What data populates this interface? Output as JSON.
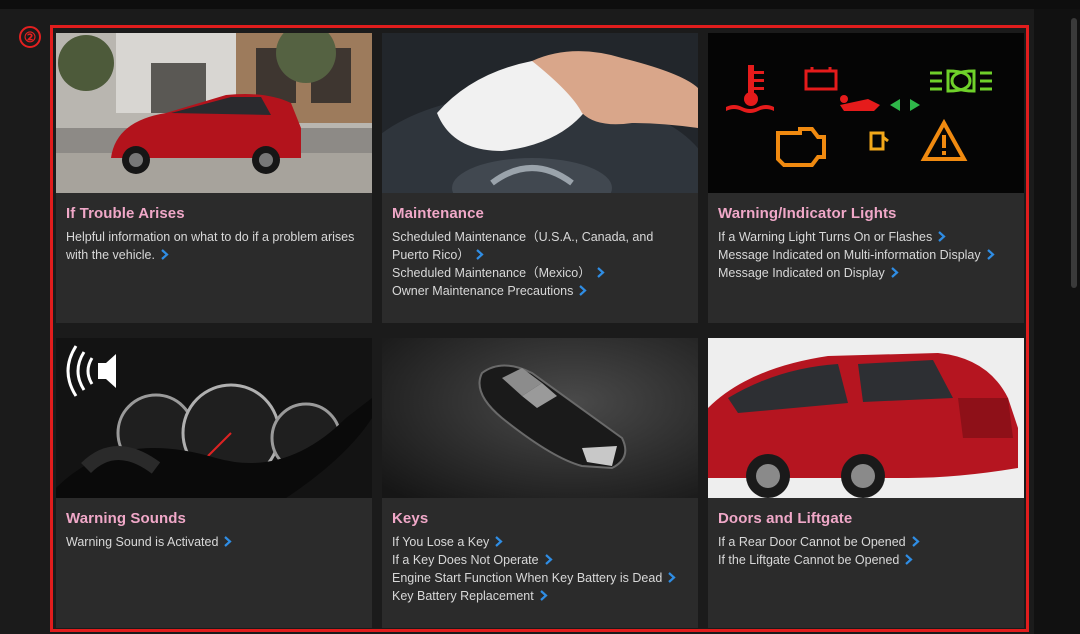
{
  "marker": {
    "label": "②"
  },
  "icons": {
    "chevron": "chevron-right-icon",
    "sound": "speaker-sound-icon"
  },
  "colors": {
    "accent_link": "#2f8de4",
    "title": "#f0a8c8",
    "frame": "#e11d1d"
  },
  "cards": [
    {
      "title": "If Trouble Arises",
      "links": [
        "Helpful information on what to do if a problem arises with the vehicle."
      ]
    },
    {
      "title": "Maintenance",
      "links": [
        "Scheduled Maintenance（U.S.A., Canada, and Puerto Rico）",
        "Scheduled Maintenance（Mexico）",
        "Owner Maintenance Precautions"
      ]
    },
    {
      "title": "Warning/Indicator Lights",
      "links": [
        "If a Warning Light Turns On or Flashes",
        "Message Indicated on Multi-information Display",
        "Message Indicated on Display"
      ]
    },
    {
      "title": "Warning Sounds",
      "links": [
        "Warning Sound is Activated"
      ]
    },
    {
      "title": "Keys",
      "links": [
        "If You Lose a Key",
        "If a Key Does Not Operate",
        "Engine Start Function When Key Battery is Dead",
        "Key Battery Replacement"
      ]
    },
    {
      "title": "Doors and Liftgate",
      "links": [
        "If a Rear Door Cannot be Opened",
        "If the Liftgate Cannot be Opened"
      ]
    }
  ]
}
